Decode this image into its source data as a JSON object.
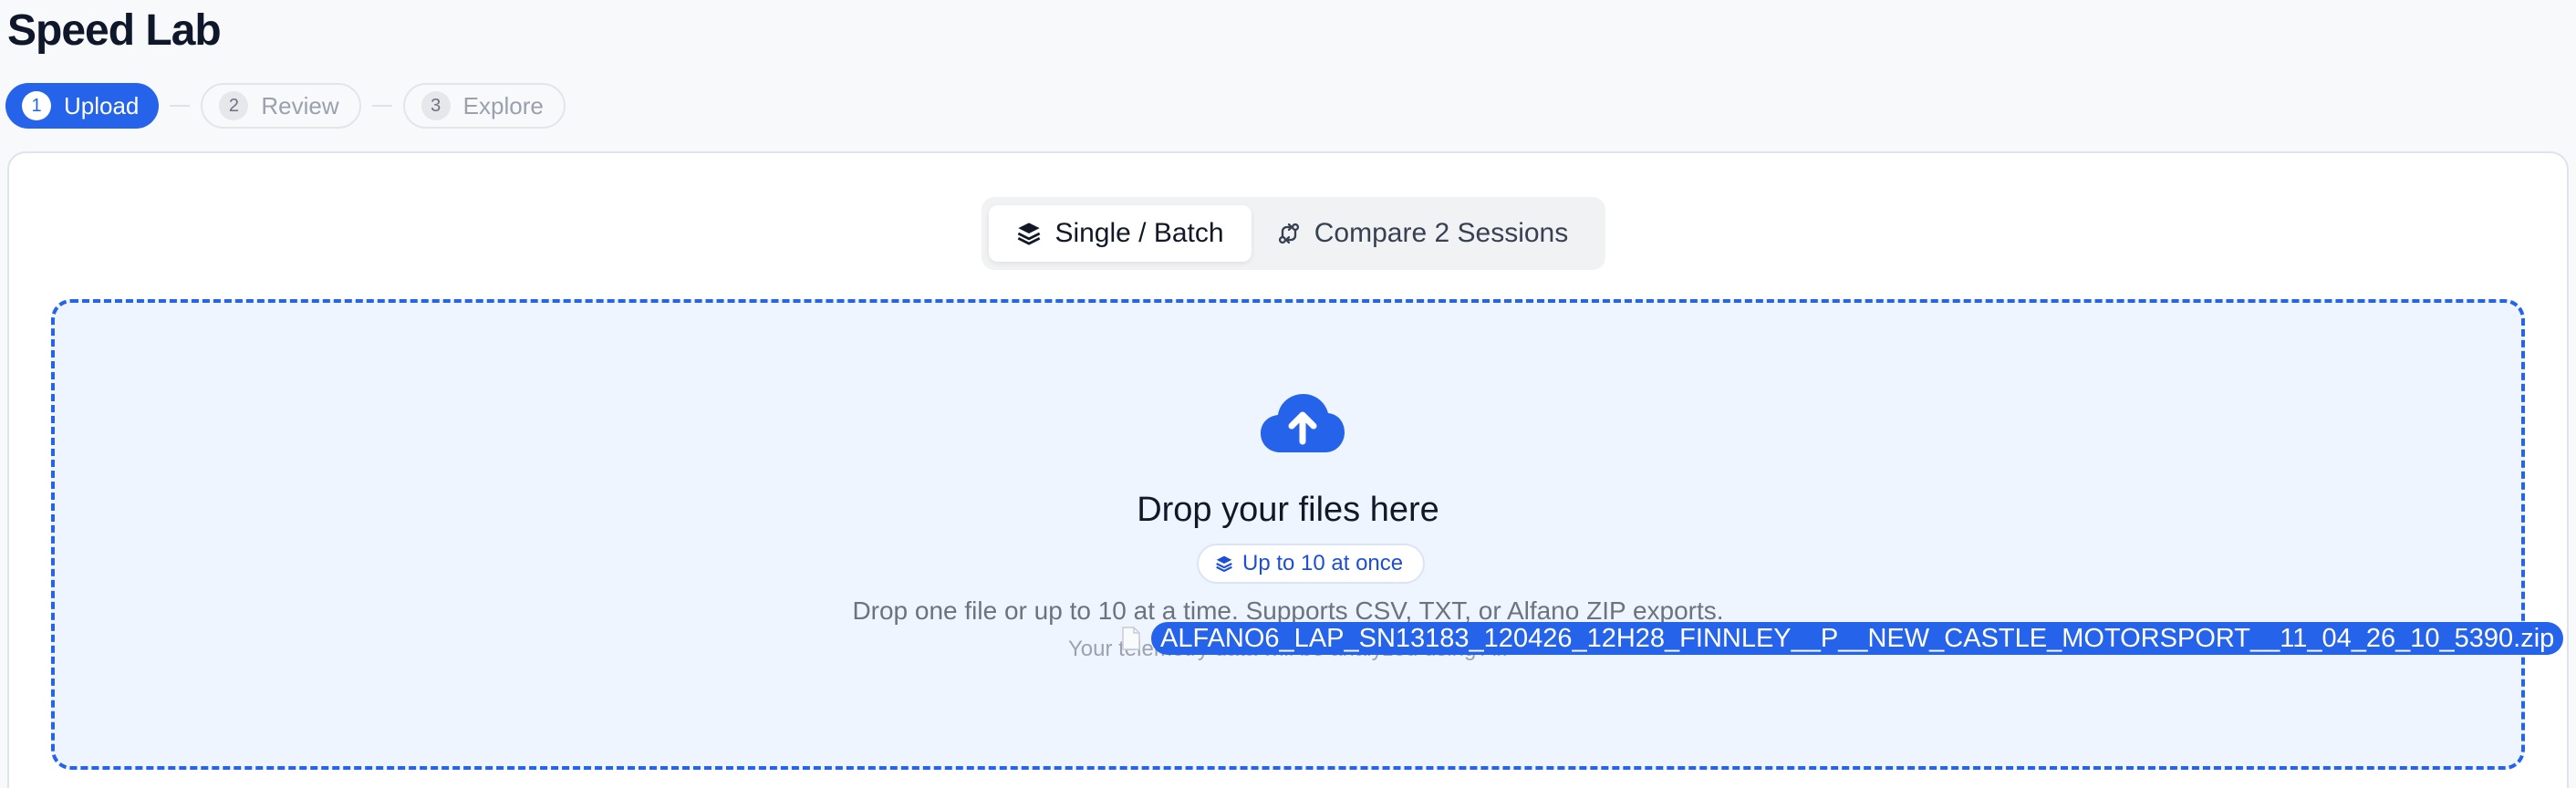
{
  "app": {
    "title": "Speed Lab"
  },
  "stepper": {
    "steps": [
      {
        "number": "1",
        "label": "Upload",
        "state": "active"
      },
      {
        "number": "2",
        "label": "Review",
        "state": "inactive"
      },
      {
        "number": "3",
        "label": "Explore",
        "state": "inactive"
      }
    ]
  },
  "mode_tabs": [
    {
      "label": "Single / Batch",
      "icon": "layers-icon",
      "active": true
    },
    {
      "label": "Compare 2 Sessions",
      "icon": "compare-arrows-icon",
      "active": false
    }
  ],
  "dropzone": {
    "icon": "cloud-upload-icon",
    "title": "Drop your files here",
    "badge": "Up to 10 at once",
    "badge_icon": "layers-icon",
    "description": "Drop one file or up to 10 at a time. Supports CSV, TXT, or Alfano ZIP exports.",
    "note": "Your telemetry data will be analyzed using AI."
  },
  "drag_ghost": {
    "icon": "file-icon",
    "file_name": "ALFANO6_LAP_SN13183_120426_12H28_FINNLEY__P__NEW_CASTLE_MOTORSPORT__11_04_26_10_5390.zip"
  },
  "colors": {
    "accent": "#2563eb",
    "background": "#f8f9fb",
    "dropzone_bg": "#eff5ff"
  }
}
